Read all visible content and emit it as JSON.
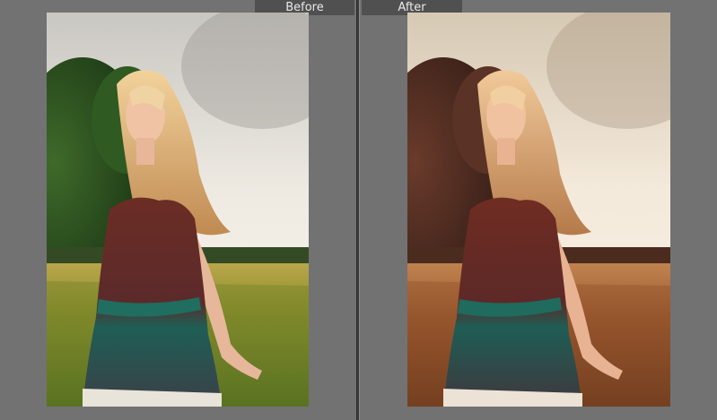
{
  "compare_view": {
    "before_label": "Before",
    "after_label": "After"
  },
  "colors": {
    "background": "#727272",
    "label_bar": "#505050",
    "label_text": "#e9e9e9",
    "divider": "#3a3a3a"
  },
  "photos": {
    "before": {
      "tone": "natural-green"
    },
    "after": {
      "tone": "warm-orange"
    }
  }
}
